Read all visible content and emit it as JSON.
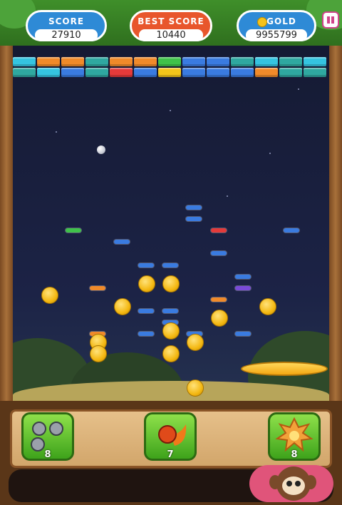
{
  "hud": {
    "score_label": "SCORE",
    "score_value": "27910",
    "best_label": "BEST SCORE",
    "best_value": "10440",
    "gold_label": "GOLD",
    "gold_value": "9955799"
  },
  "powerups": [
    {
      "name": "multi-ball",
      "icon": "triple-ball-icon",
      "count": "8"
    },
    {
      "name": "fireball",
      "icon": "fireball-icon",
      "count": "7"
    },
    {
      "name": "explosion",
      "icon": "explosion-icon",
      "count": "8"
    }
  ],
  "colors": {
    "brick_cyan": "#35c4e0",
    "brick_orange": "#f08a2a",
    "brick_teal": "#2fa8a0",
    "brick_green": "#3fc24a",
    "brick_blue": "#3a7be0",
    "brick_red": "#e43a3a",
    "brick_yellow": "#f2c51a",
    "brick_purple": "#7a4ad8"
  },
  "brick_rows": [
    [
      "cyan",
      "orange",
      "orange",
      "teal",
      "orange",
      "orange",
      "green",
      "blue",
      "blue",
      "teal",
      "cyan",
      "teal",
      "cyan"
    ],
    [
      "teal",
      "cyan",
      "blue",
      "teal",
      "red",
      "blue",
      "yellow",
      "blue",
      "blue",
      "blue",
      "orange",
      "teal",
      "teal"
    ]
  ]
}
